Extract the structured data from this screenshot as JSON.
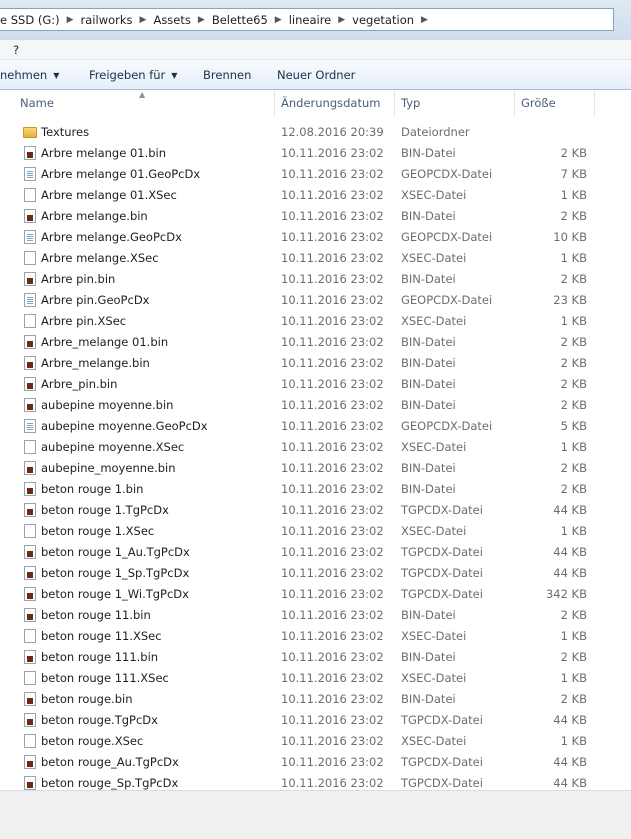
{
  "address": {
    "crumbs": [
      "e SSD (G:)",
      "railworks",
      "Assets",
      "Belette65",
      "lineaire",
      "vegetation"
    ]
  },
  "menu": {
    "items": [
      "?"
    ]
  },
  "toolbar": {
    "share_with_partial": "nehmen",
    "share_label": "Freigeben für",
    "burn_label": "Brennen",
    "new_folder_label": "Neuer Ordner"
  },
  "columns": {
    "name": "Name",
    "date": "Änderungsdatum",
    "type": "Typ",
    "size": "Größe"
  },
  "files": [
    {
      "name": "Textures",
      "date": "12.08.2016 20:39",
      "type": "Dateiordner",
      "size": "",
      "icon": "folder-icon"
    },
    {
      "name": "Arbre melange 01.bin",
      "date": "10.11.2016 23:02",
      "type": "BIN-Datei",
      "size": "2 KB",
      "icon": "bin-file-icon"
    },
    {
      "name": "Arbre melange 01.GeoPcDx",
      "date": "10.11.2016 23:02",
      "type": "GEOPCDX-Datei",
      "size": "7 KB",
      "icon": "geo-file-icon"
    },
    {
      "name": "Arbre melange 01.XSec",
      "date": "10.11.2016 23:02",
      "type": "XSEC-Datei",
      "size": "1 KB",
      "icon": "blank-file-icon"
    },
    {
      "name": "Arbre melange.bin",
      "date": "10.11.2016 23:02",
      "type": "BIN-Datei",
      "size": "2 KB",
      "icon": "bin-file-icon"
    },
    {
      "name": "Arbre melange.GeoPcDx",
      "date": "10.11.2016 23:02",
      "type": "GEOPCDX-Datei",
      "size": "10 KB",
      "icon": "geo-file-icon"
    },
    {
      "name": "Arbre melange.XSec",
      "date": "10.11.2016 23:02",
      "type": "XSEC-Datei",
      "size": "1 KB",
      "icon": "blank-file-icon"
    },
    {
      "name": "Arbre pin.bin",
      "date": "10.11.2016 23:02",
      "type": "BIN-Datei",
      "size": "2 KB",
      "icon": "bin-file-icon"
    },
    {
      "name": "Arbre pin.GeoPcDx",
      "date": "10.11.2016 23:02",
      "type": "GEOPCDX-Datei",
      "size": "23 KB",
      "icon": "geo-file-icon"
    },
    {
      "name": "Arbre pin.XSec",
      "date": "10.11.2016 23:02",
      "type": "XSEC-Datei",
      "size": "1 KB",
      "icon": "blank-file-icon"
    },
    {
      "name": "Arbre_melange 01.bin",
      "date": "10.11.2016 23:02",
      "type": "BIN-Datei",
      "size": "2 KB",
      "icon": "bin-file-icon"
    },
    {
      "name": "Arbre_melange.bin",
      "date": "10.11.2016 23:02",
      "type": "BIN-Datei",
      "size": "2 KB",
      "icon": "bin-file-icon"
    },
    {
      "name": "Arbre_pin.bin",
      "date": "10.11.2016 23:02",
      "type": "BIN-Datei",
      "size": "2 KB",
      "icon": "bin-file-icon"
    },
    {
      "name": "aubepine moyenne.bin",
      "date": "10.11.2016 23:02",
      "type": "BIN-Datei",
      "size": "2 KB",
      "icon": "bin-file-icon"
    },
    {
      "name": "aubepine moyenne.GeoPcDx",
      "date": "10.11.2016 23:02",
      "type": "GEOPCDX-Datei",
      "size": "5 KB",
      "icon": "geo-file-icon"
    },
    {
      "name": "aubepine moyenne.XSec",
      "date": "10.11.2016 23:02",
      "type": "XSEC-Datei",
      "size": "1 KB",
      "icon": "blank-file-icon"
    },
    {
      "name": "aubepine_moyenne.bin",
      "date": "10.11.2016 23:02",
      "type": "BIN-Datei",
      "size": "2 KB",
      "icon": "bin-file-icon"
    },
    {
      "name": "beton rouge 1.bin",
      "date": "10.11.2016 23:02",
      "type": "BIN-Datei",
      "size": "2 KB",
      "icon": "bin-file-icon"
    },
    {
      "name": "beton rouge 1.TgPcDx",
      "date": "10.11.2016 23:02",
      "type": "TGPCDX-Datei",
      "size": "44 KB",
      "icon": "bin-file-icon"
    },
    {
      "name": "beton rouge 1.XSec",
      "date": "10.11.2016 23:02",
      "type": "XSEC-Datei",
      "size": "1 KB",
      "icon": "blank-file-icon"
    },
    {
      "name": "beton rouge 1_Au.TgPcDx",
      "date": "10.11.2016 23:02",
      "type": "TGPCDX-Datei",
      "size": "44 KB",
      "icon": "bin-file-icon"
    },
    {
      "name": "beton rouge 1_Sp.TgPcDx",
      "date": "10.11.2016 23:02",
      "type": "TGPCDX-Datei",
      "size": "44 KB",
      "icon": "bin-file-icon"
    },
    {
      "name": "beton rouge 1_Wi.TgPcDx",
      "date": "10.11.2016 23:02",
      "type": "TGPCDX-Datei",
      "size": "342 KB",
      "icon": "bin-file-icon"
    },
    {
      "name": "beton rouge 11.bin",
      "date": "10.11.2016 23:02",
      "type": "BIN-Datei",
      "size": "2 KB",
      "icon": "bin-file-icon"
    },
    {
      "name": "beton rouge 11.XSec",
      "date": "10.11.2016 23:02",
      "type": "XSEC-Datei",
      "size": "1 KB",
      "icon": "blank-file-icon"
    },
    {
      "name": "beton rouge 111.bin",
      "date": "10.11.2016 23:02",
      "type": "BIN-Datei",
      "size": "2 KB",
      "icon": "bin-file-icon"
    },
    {
      "name": "beton rouge 111.XSec",
      "date": "10.11.2016 23:02",
      "type": "XSEC-Datei",
      "size": "1 KB",
      "icon": "blank-file-icon"
    },
    {
      "name": "beton rouge.bin",
      "date": "10.11.2016 23:02",
      "type": "BIN-Datei",
      "size": "2 KB",
      "icon": "bin-file-icon"
    },
    {
      "name": "beton rouge.TgPcDx",
      "date": "10.11.2016 23:02",
      "type": "TGPCDX-Datei",
      "size": "44 KB",
      "icon": "bin-file-icon"
    },
    {
      "name": "beton rouge.XSec",
      "date": "10.11.2016 23:02",
      "type": "XSEC-Datei",
      "size": "1 KB",
      "icon": "blank-file-icon"
    },
    {
      "name": "beton rouge_Au.TgPcDx",
      "date": "10.11.2016 23:02",
      "type": "TGPCDX-Datei",
      "size": "44 KB",
      "icon": "bin-file-icon"
    },
    {
      "name": "beton rouge_Sp.TgPcDx",
      "date": "10.11.2016 23:02",
      "type": "TGPCDX-Datei",
      "size": "44 KB",
      "icon": "bin-file-icon"
    }
  ]
}
